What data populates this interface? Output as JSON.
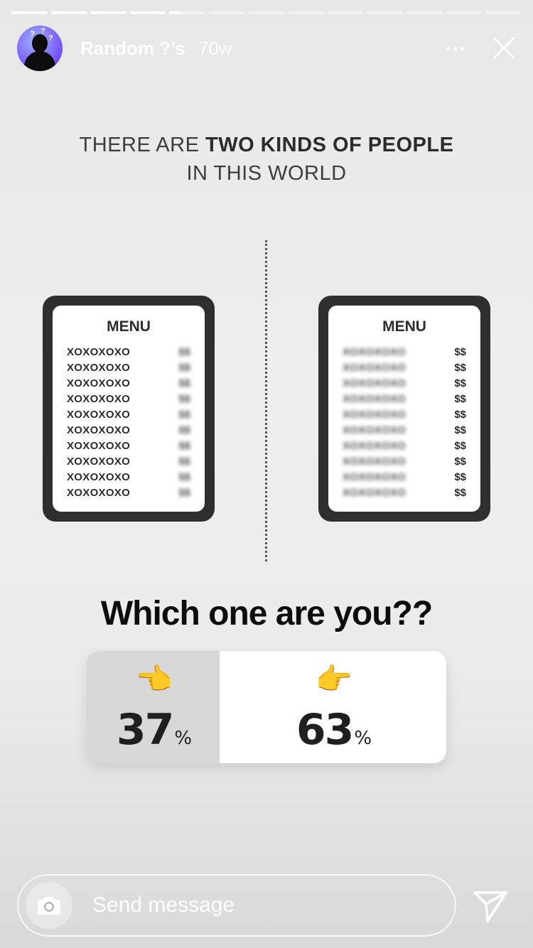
{
  "story": {
    "segments_total": 13,
    "segments_completed": 4,
    "current_segment_progress": 0.3
  },
  "header": {
    "username": "Random ?’s",
    "time_ago": "70w",
    "avatar_icon": "avatar-silhouette-icon",
    "more_icon": "more-icon",
    "close_icon": "close-icon"
  },
  "content": {
    "headline_line1_prefix": "THERE ARE ",
    "headline_line1_strong": "TWO KINDS OF PEOPLE",
    "headline_line2": "IN THIS WORLD",
    "left_menu": {
      "title": "MENU",
      "items": [
        "XOXOXOXO",
        "XOXOXOXO",
        "XOXOXOXO",
        "XOXOXOXO",
        "XOXOXOXO",
        "XOXOXOXO",
        "XOXOXOXO",
        "XOXOXOXO",
        "XOXOXOXO",
        "XOXOXOXO"
      ],
      "prices": [
        "$$",
        "$$",
        "$$",
        "$$",
        "$$",
        "$$",
        "$$",
        "$$",
        "$$",
        "$$"
      ],
      "prices_blurred": true
    },
    "right_menu": {
      "title": "MENU",
      "items": [
        "XOXOXOXO",
        "XOXOXOXO",
        "XOXOXOXO",
        "XOXOXOXO",
        "XOXOXOXO",
        "XOXOXOXO",
        "XOXOXOXO",
        "XOXOXOXO",
        "XOXOXOXO",
        "XOXOXOXO"
      ],
      "prices": [
        "$$",
        "$$",
        "$$",
        "$$",
        "$$",
        "$$",
        "$$",
        "$$",
        "$$",
        "$$"
      ],
      "items_blurred": true
    }
  },
  "poll": {
    "question": "Which one are you??",
    "options": [
      {
        "emoji": "👈",
        "value": "37",
        "percent_sign": "%",
        "share": 0.37,
        "icon": "backhand-pointing-left-icon"
      },
      {
        "emoji": "👉",
        "value": "63",
        "percent_sign": "%",
        "share": 0.63,
        "icon": "backhand-pointing-right-icon"
      }
    ]
  },
  "footer": {
    "placeholder": "Send message",
    "camera_icon": "camera-icon",
    "share_icon": "send-icon"
  },
  "colors": {
    "text_dark": "#0d0d0d",
    "poll_fill": "#d8d8d8",
    "menu_frame": "#2f2f2f"
  }
}
